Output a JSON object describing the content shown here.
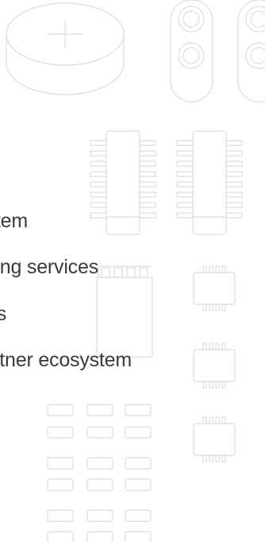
{
  "menu": {
    "items": [
      {
        "label": "Intelligent Home System"
      },
      {
        "label": "Embedded engineering services"
      },
      {
        "label": "Hardware products"
      },
      {
        "label": "Cloud platform and Partner ecosystem"
      }
    ]
  },
  "decor": {
    "stroke_color": "#dcdcdc",
    "icons": [
      "battery-cell-icon",
      "inductor-coil-icon",
      "dip-chip-icon",
      "smd-chip-icon",
      "smd-resistor-icon"
    ]
  }
}
